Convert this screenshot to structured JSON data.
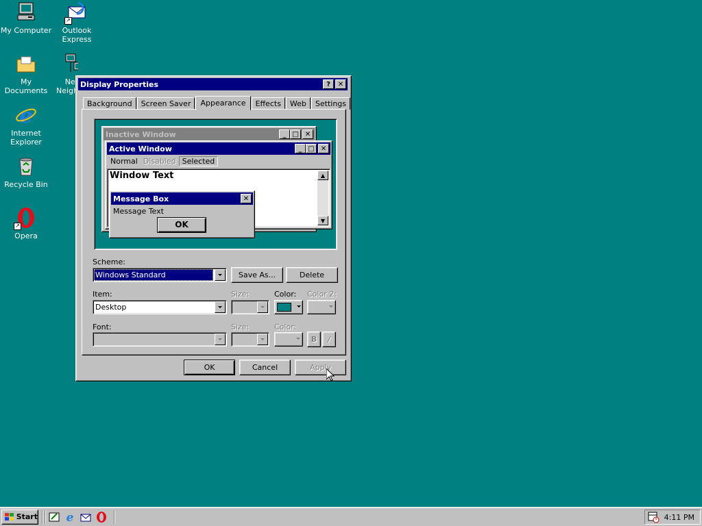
{
  "desktop": {
    "background_color": "#008080",
    "icons": [
      {
        "label": "My Computer",
        "icon": "computer-icon"
      },
      {
        "label": "Outlook Express",
        "icon": "outlook-express-icon"
      },
      {
        "label": "My Documents",
        "icon": "folder-icon"
      },
      {
        "label": "Net Neigh",
        "icon": "network-neighborhood-icon"
      },
      {
        "label": "Internet Explorer",
        "icon": "internet-explorer-icon"
      },
      {
        "label": "Recycle Bin",
        "icon": "recycle-bin-icon"
      },
      {
        "label": "Opera",
        "icon": "opera-icon"
      }
    ]
  },
  "dialog": {
    "title": "Display Properties",
    "help_btn": "?",
    "close_btn": "✕",
    "tabs": [
      "Background",
      "Screen Saver",
      "Appearance",
      "Effects",
      "Web",
      "Settings"
    ],
    "active_tab": "Appearance",
    "preview": {
      "inactive_title": "Inactive Window",
      "active_title": "Active Window",
      "menu_normal": "Normal",
      "menu_disabled": "Disabled",
      "menu_selected": "Selected",
      "window_text": "Window Text",
      "msgbox_title": "Message Box",
      "msgbox_text": "Message Text",
      "msgbox_ok": "OK"
    },
    "scheme_label": "Scheme:",
    "scheme_value": "Windows Standard",
    "save_as_label": "Save As...",
    "delete_label": "Delete",
    "item_label": "Item:",
    "item_value": "Desktop",
    "size_label": "Size:",
    "color_label": "Color:",
    "color2_label": "Color 2:",
    "color_value": "#008080",
    "font_label": "Font:",
    "font_size_label": "Size:",
    "font_color_label": "Color:",
    "bold_btn": "B",
    "italic_btn": "/",
    "ok_label": "OK",
    "cancel_label": "Cancel",
    "apply_label": "Apply"
  },
  "taskbar": {
    "start_label": "Start",
    "clock": "4:11 PM"
  }
}
